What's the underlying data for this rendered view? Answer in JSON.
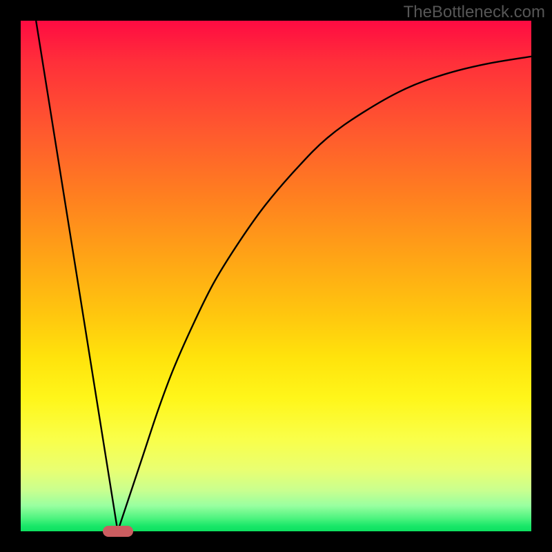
{
  "watermark": "TheBottleneck.com",
  "chart_data": {
    "type": "line",
    "title": "",
    "xlabel": "",
    "ylabel": "",
    "xlim": [
      0,
      100
    ],
    "ylim": [
      0,
      100
    ],
    "grid": false,
    "legend": false,
    "series": [
      {
        "name": "left-line",
        "x": [
          3,
          19
        ],
        "y": [
          100,
          0
        ]
      },
      {
        "name": "right-curve",
        "x": [
          19,
          21,
          24,
          27,
          30,
          34,
          38,
          43,
          48,
          54,
          60,
          67,
          75,
          83,
          91,
          100
        ],
        "y": [
          0,
          6,
          15,
          24,
          32,
          41,
          49,
          57,
          64,
          71,
          77,
          82,
          86.5,
          89.5,
          91.5,
          93
        ]
      }
    ],
    "marker": {
      "x": 19,
      "y": 0,
      "color": "#cb5d60"
    },
    "background_gradient": {
      "top": "#ff0b42",
      "mid": "#ffe30c",
      "bottom": "#0ee060"
    }
  }
}
